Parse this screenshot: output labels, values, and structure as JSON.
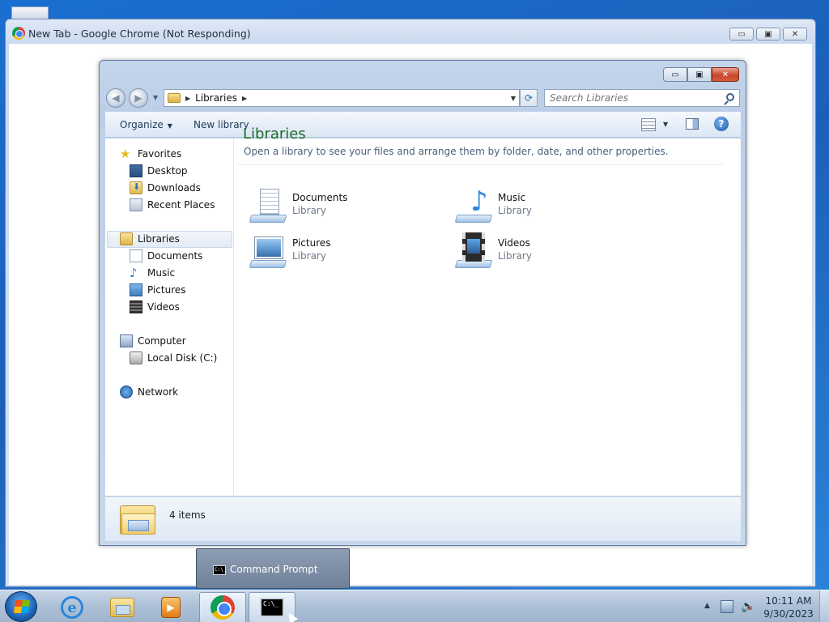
{
  "chrome": {
    "title": "New Tab - Google Chrome (Not Responding)",
    "minimize_glyph": "▭",
    "maximize_glyph": "▣",
    "close_glyph": "✕"
  },
  "explorer": {
    "controls": {
      "minimize": "▭",
      "maximize": "▣",
      "close": "✕"
    },
    "address": {
      "path": "Libraries",
      "separator": "▶"
    },
    "search": {
      "placeholder": "Search Libraries"
    },
    "toolbar": {
      "organize": "Organize",
      "new_library": "New library"
    },
    "nav_pane": {
      "favorites": "Favorites",
      "favorites_items": [
        "Desktop",
        "Downloads",
        "Recent Places"
      ],
      "libraries": "Libraries",
      "libraries_items": [
        "Documents",
        "Music",
        "Pictures",
        "Videos"
      ],
      "computer": "Computer",
      "computer_items": [
        "Local Disk (C:)"
      ],
      "network": "Network"
    },
    "main": {
      "title": "Libraries",
      "subtitle": "Open a library to see your files and arrange them by folder, date, and other properties.",
      "items": [
        {
          "name": "Documents",
          "type": "Library",
          "icon": "documents-library-icon"
        },
        {
          "name": "Music",
          "type": "Library",
          "icon": "music-library-icon"
        },
        {
          "name": "Pictures",
          "type": "Library",
          "icon": "pictures-library-icon"
        },
        {
          "name": "Videos",
          "type": "Library",
          "icon": "videos-library-icon"
        }
      ]
    },
    "details": {
      "count": "4 items"
    }
  },
  "taskbar": {
    "popup_label": "Command Prompt",
    "cmd_glyph": "C:\\_",
    "media_glyph": "▶",
    "ie_glyph": "e",
    "tray_arrow": "▲",
    "volume_glyph": "🔈",
    "clock": {
      "time": "10:11 AM",
      "date": "9/30/2023"
    }
  }
}
